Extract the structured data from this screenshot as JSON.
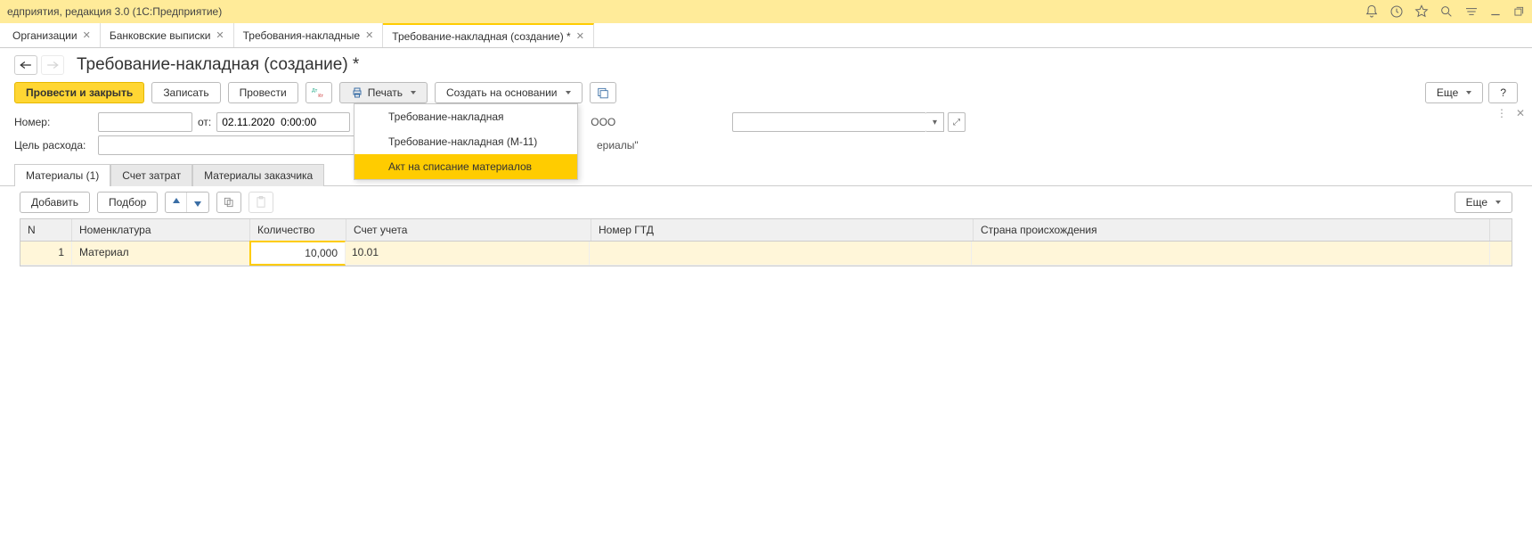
{
  "titlebar": {
    "text": "едприятия, редакция 3.0  (1С:Предприятие)"
  },
  "tabs": [
    {
      "label": "Организации"
    },
    {
      "label": "Банковские выписки"
    },
    {
      "label": "Требования-накладные"
    },
    {
      "label": "Требование-накладная (создание) *",
      "active": true
    }
  ],
  "page": {
    "title": "Требование-накладная (создание) *"
  },
  "toolbar": {
    "post_close": "Провести и закрыть",
    "write": "Записать",
    "post": "Провести",
    "print": "Печать",
    "create_based": "Создать на основании",
    "more": "Еще",
    "help": "?"
  },
  "print_menu": {
    "items": [
      "Требование-накладная",
      "Требование-накладная (М-11)",
      "Акт на списание материалов"
    ],
    "highlighted": 2
  },
  "form": {
    "number_label": "Номер:",
    "number_value": "",
    "date_label": "от:",
    "date_value": "02.11.2020  0:00:00",
    "org_partial": "ООО",
    "purpose_label": "Цель расхода:",
    "purpose_value": "",
    "text_behind": "ериалы\""
  },
  "sub_tabs": [
    {
      "label": "Материалы (1)",
      "active": true
    },
    {
      "label": "Счет затрат"
    },
    {
      "label": "Материалы заказчика"
    }
  ],
  "sub_toolbar": {
    "add": "Добавить",
    "pick": "Подбор",
    "more": "Еще"
  },
  "grid": {
    "headers": {
      "n": "N",
      "nomenclature": "Номенклатура",
      "quantity": "Количество",
      "account": "Счет учета",
      "gtd": "Номер ГТД",
      "country": "Страна происхождения"
    },
    "rows": [
      {
        "n": "1",
        "nomenclature": "Материал",
        "quantity": "10,000",
        "account": "10.01",
        "gtd": "",
        "country": ""
      }
    ]
  }
}
